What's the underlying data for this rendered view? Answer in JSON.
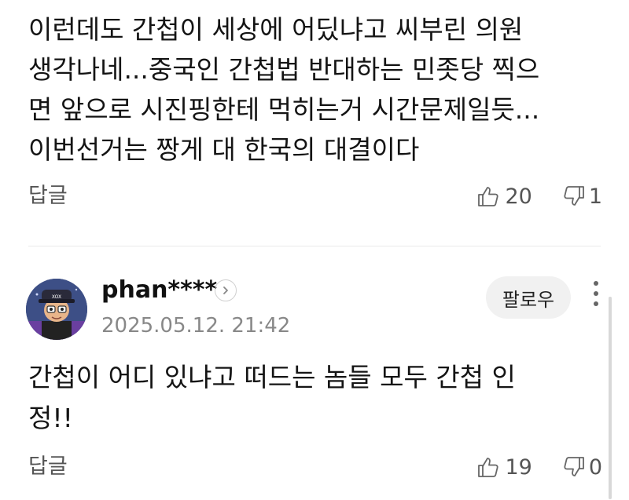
{
  "comment1": {
    "lines": [
      "이런데도 간첩이 세상에 어딨냐고 씨부린 의원",
      "생각나네...중국인 간첩법 반대하는 민좃당 찍으",
      "면 앞으로 시진핑한테 먹히는거 시간문제일듯...",
      "이번선거는 짱게 대 한국의 대결이다"
    ],
    "reply_label": "답글",
    "likes": "20",
    "dislikes": "1"
  },
  "comment2": {
    "username": "phan****",
    "timestamp": "2025.05.12. 21:42",
    "follow_label": "팔로우",
    "lines": [
      "간첩이 어디 있냐고 떠드는 놈들 모두 간첩 인",
      "정!!"
    ],
    "reply_label": "답글",
    "likes": "19",
    "dislikes": "0"
  },
  "icons": {
    "like": "thumbs-up-icon",
    "dislike": "thumbs-down-icon",
    "more": "more-vertical-icon",
    "profile_arrow": "chevron-right-icon"
  }
}
